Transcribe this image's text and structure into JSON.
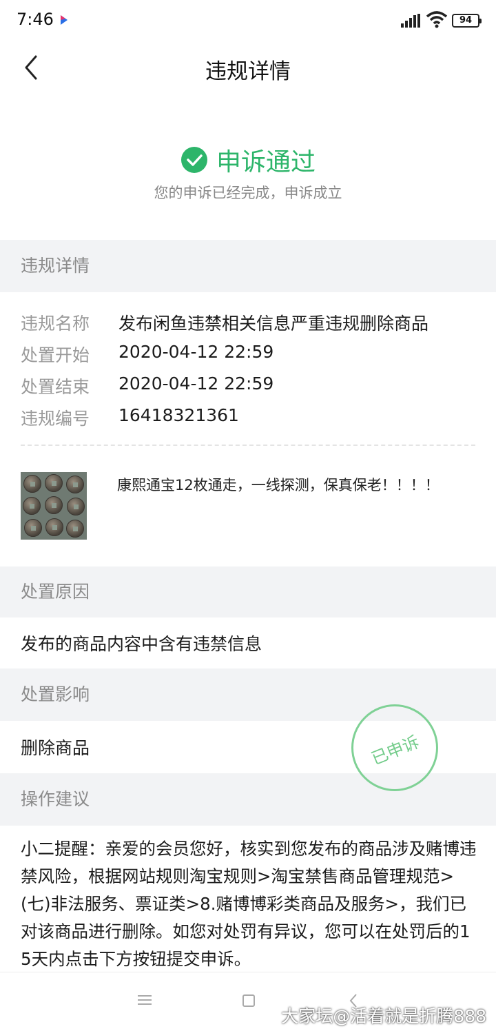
{
  "status_bar": {
    "time": "7:46",
    "battery": "94"
  },
  "header": {
    "title": "违规详情"
  },
  "result": {
    "title": "申诉通过",
    "subtitle": "您的申诉已经完成，申诉成立",
    "accent_color": "#2db56a"
  },
  "details": {
    "section_title": "违规详情",
    "rows": [
      {
        "label": "违规名称",
        "value": "发布闲鱼违禁相关信息严重违规删除商品"
      },
      {
        "label": "处置开始",
        "value": "2020-04-12 22:59"
      },
      {
        "label": "处置结束",
        "value": "2020-04-12 22:59"
      },
      {
        "label": "违规编号",
        "value": "16418321361"
      }
    ],
    "product": {
      "title": "康熙通宝12枚通走，一线探测，保真保老！！！！"
    }
  },
  "reason": {
    "section_title": "处置原因",
    "text": "发布的商品内容中含有违禁信息"
  },
  "impact": {
    "section_title": "处置影响",
    "text": "删除商品",
    "stamp": "已申诉"
  },
  "advice": {
    "section_title": "操作建议",
    "text": "小二提醒：亲爱的会员您好，核实到您发布的商品涉及赌博违禁风险，根据网站规则淘宝规则>淘宝禁售商品管理规范>(七)非法服务、票证类>8.赌博博彩类商品及服务>，我们已对该商品进行删除。如您对处罚有异议，您可以在处罚后的15天内点击下方按钮提交申诉。"
  },
  "watermark": "大家坛@活着就是折腾888"
}
